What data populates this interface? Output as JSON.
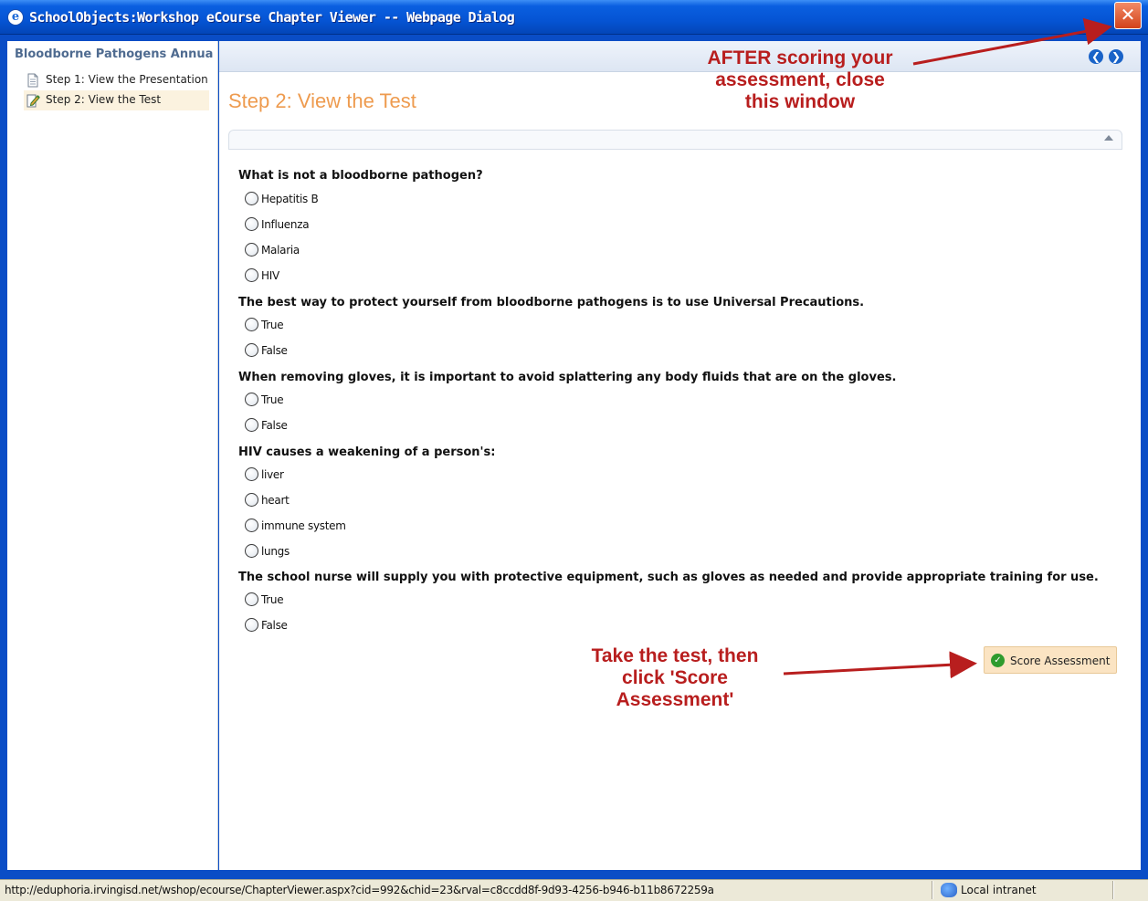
{
  "window": {
    "title": "SchoolObjects:Workshop eCourse Chapter Viewer -- Webpage Dialog",
    "app_icon": "ie-icon",
    "close_label": "✕"
  },
  "sidebar": {
    "title": "Bloodborne Pathogens Annua",
    "items": [
      {
        "label": "Step 1: View the Presentation",
        "icon": "document-icon",
        "active": false
      },
      {
        "label": "Step 2: View the Test",
        "icon": "edit-document-icon",
        "active": true
      }
    ]
  },
  "nav": {
    "back_icon": "back-arrow-icon",
    "forward_icon": "forward-arrow-icon",
    "back_glyph": "❮",
    "forward_glyph": "❯"
  },
  "main": {
    "title": "Step 2: View the Test",
    "questions": [
      {
        "text": "What is not a bloodborne pathogen?",
        "options": [
          "Hepatitis B",
          "Influenza",
          "Malaria",
          "HIV"
        ]
      },
      {
        "text": "The best way to protect yourself from bloodborne pathogens is to use Universal Precautions.",
        "options": [
          "True",
          "False"
        ]
      },
      {
        "text": "When removing gloves, it is important to avoid splattering any body fluids that are on the gloves.",
        "options": [
          "True",
          "False"
        ]
      },
      {
        "text": "HIV causes a weakening of a person's:",
        "options": [
          "liver",
          "heart",
          "immune system",
          "lungs"
        ]
      },
      {
        "text": "The school nurse will supply you with protective equipment, such as gloves as needed and provide appropriate training for use.",
        "options": [
          "True",
          "False"
        ]
      }
    ],
    "score_button": "Score Assessment"
  },
  "annotations": {
    "top": [
      "AFTER scoring your",
      "assessment, close",
      "this window"
    ],
    "bottom": [
      "Take the test, then",
      "click 'Score",
      "Assessment'"
    ],
    "color": "#b81e1e"
  },
  "statusbar": {
    "url": "http://eduphoria.irvingisd.net/wshop/ecourse/ChapterViewer.aspx?cid=992&chid=23&rval=c8ccdd8f-9d93-4256-b946-b11b8672259a",
    "zone": "Local intranet"
  }
}
